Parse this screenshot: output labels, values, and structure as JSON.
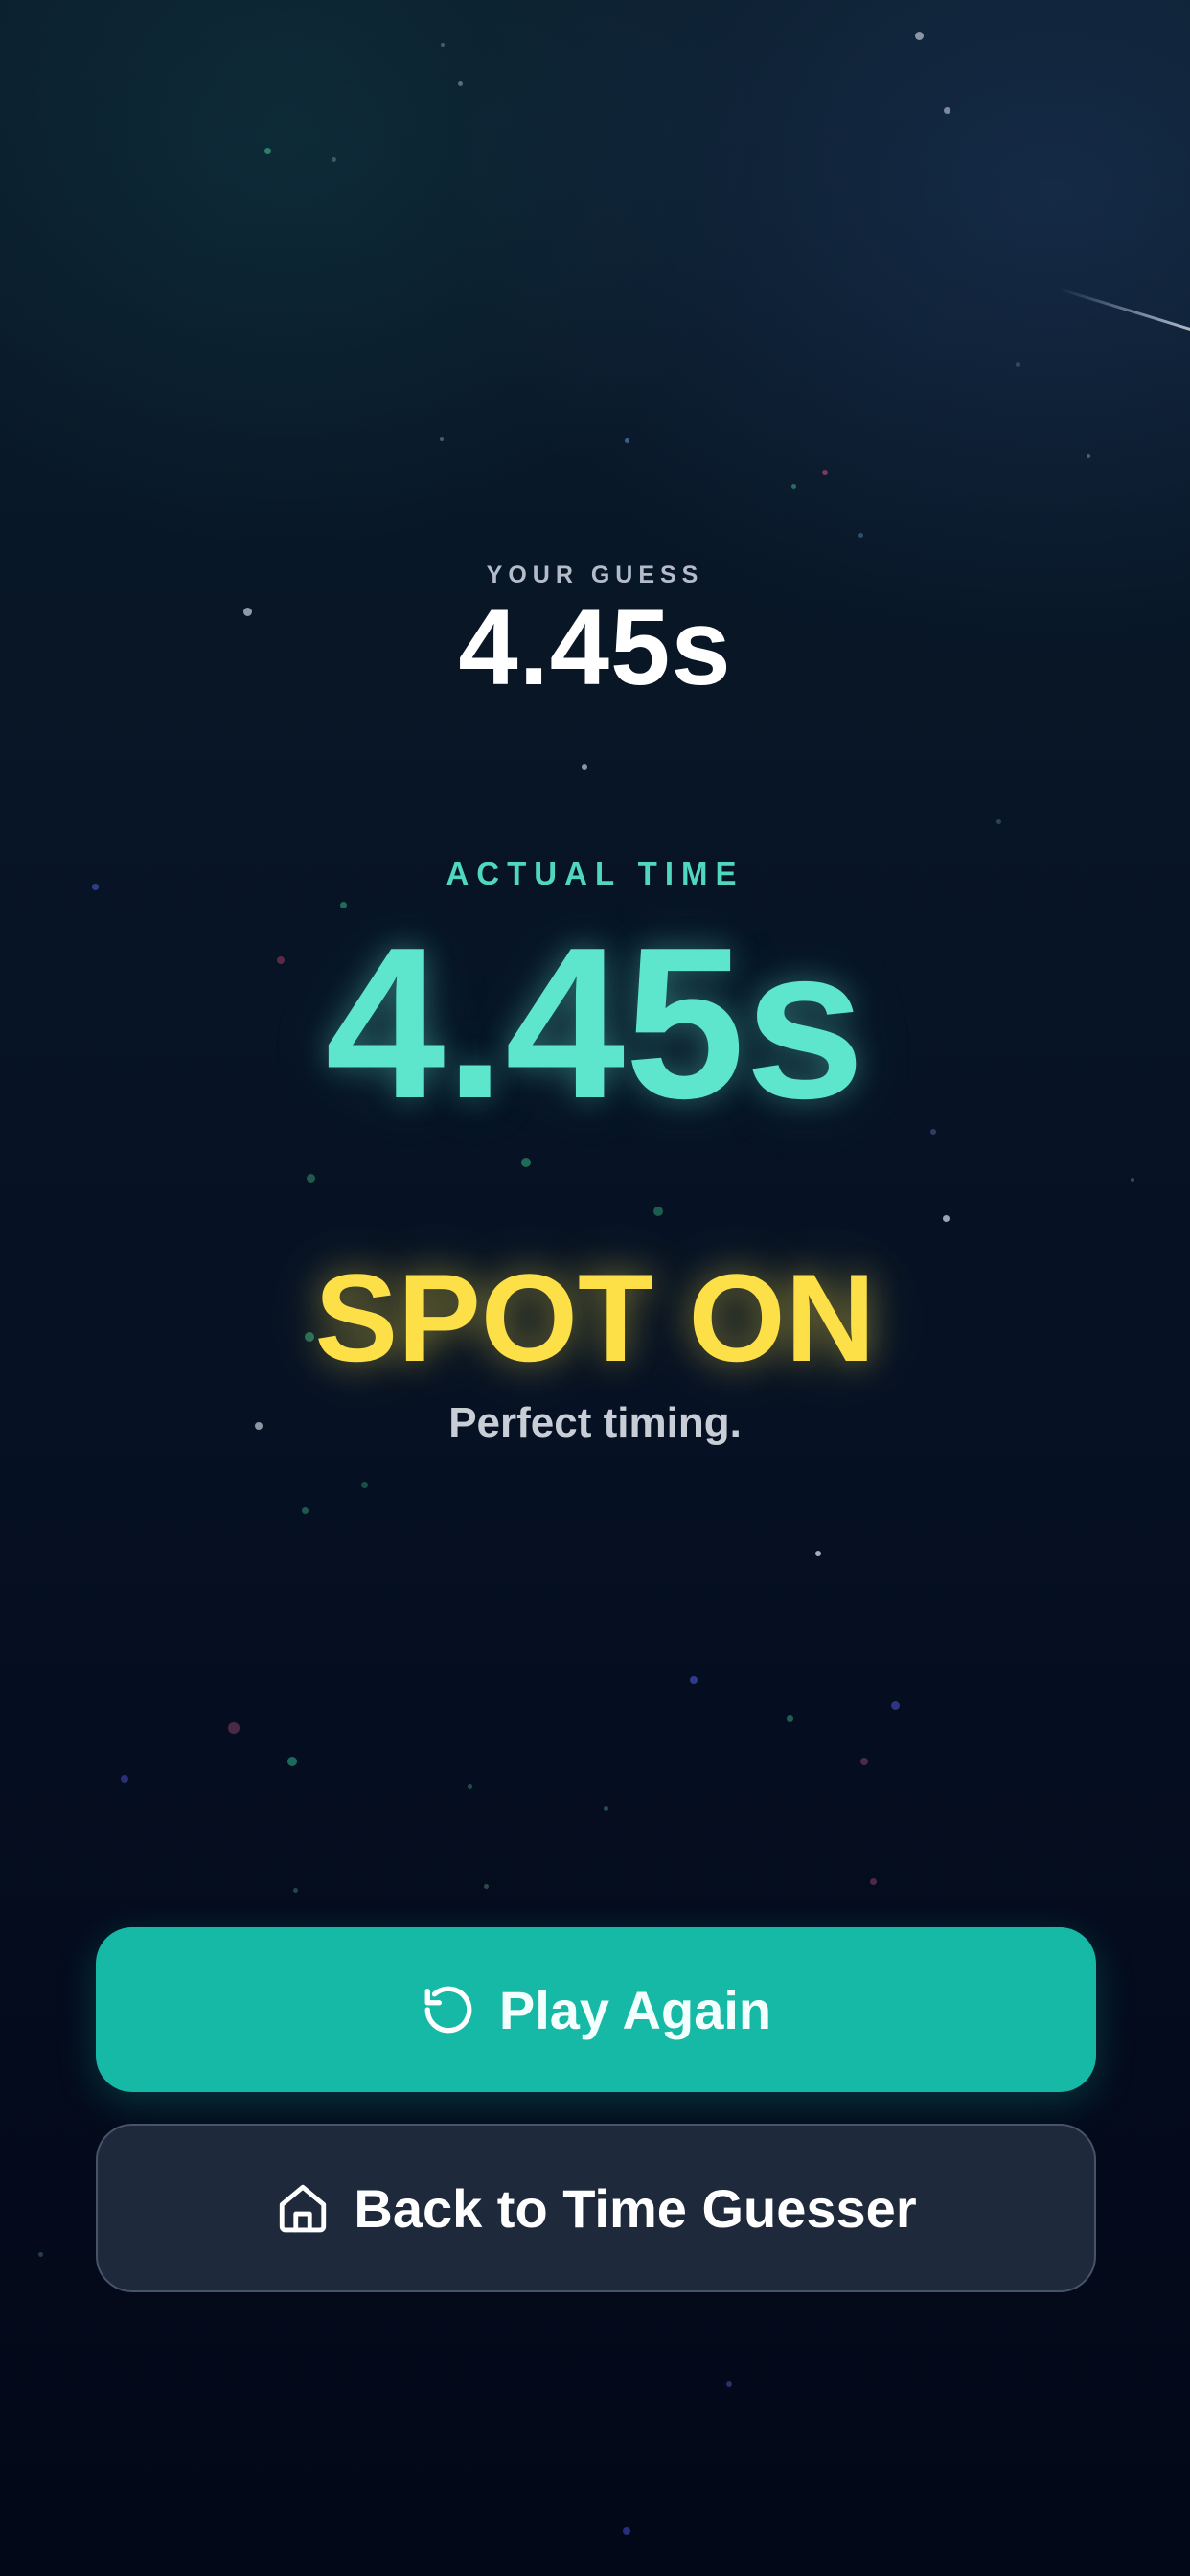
{
  "result": {
    "guess_label": "YOUR GUESS",
    "guess_value": "4.45s",
    "actual_label": "ACTUAL TIME",
    "actual_value": "4.45s",
    "verdict": "SPOT ON",
    "verdict_subtitle": "Perfect timing."
  },
  "actions": {
    "play_again": {
      "label": "Play Again",
      "icon": "refresh-icon"
    },
    "back": {
      "label": "Back to Time Guesser",
      "icon": "home-icon"
    }
  },
  "colors": {
    "accent_teal": "#15b9a5",
    "actual_time": "#5ee6cc",
    "verdict": "#fde047",
    "secondary_button": "#1e293b"
  }
}
